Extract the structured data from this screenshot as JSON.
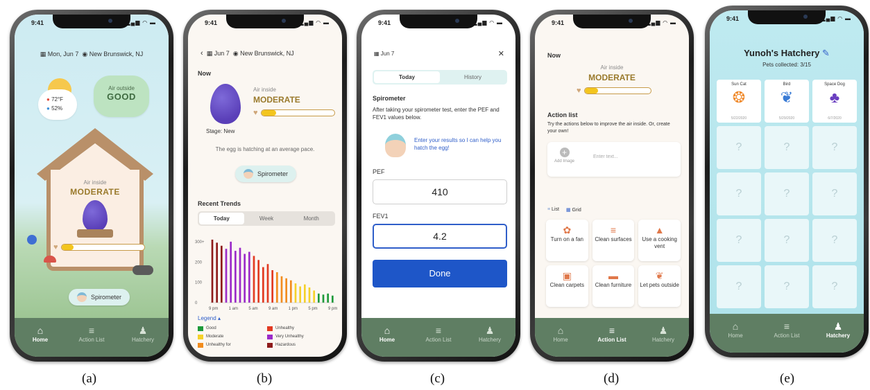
{
  "status_bar": {
    "time": "9:41",
    "signal": "▂▄▆ ◠ ▬"
  },
  "tabs": {
    "home": "Home",
    "action_list": "Action List",
    "hatchery": "Hatchery"
  },
  "captions": [
    "(a)",
    "(b)",
    "(c)",
    "(d)",
    "(e)"
  ],
  "screen_a": {
    "date": "Mon, Jun 7",
    "location": "New Brunswick, NJ",
    "temperature": "72°F",
    "humidity": "52%",
    "air_outside_label": "Air outside",
    "air_outside_value": "GOOD",
    "air_inside_label": "Air inside",
    "air_inside_value": "MODERATE",
    "meter_fraction": 0.15,
    "spirometer_label": "Spirometer"
  },
  "screen_b": {
    "date": "Jun 7",
    "location": "New Brunswick, NJ",
    "now_label": "Now",
    "air_inside_label": "Air inside",
    "air_inside_value": "MODERATE",
    "stage_text": "Stage: New",
    "hatch_text": "The egg is hatching at an average pace.",
    "spirometer_label": "Spirometer",
    "recent_trends": "Recent Trends",
    "seg_tabs": [
      "Today",
      "Week",
      "Month"
    ],
    "legend_title": "Legend",
    "legend": [
      {
        "label": "Good",
        "color": "#1e9a3a"
      },
      {
        "label": "Unhealthy",
        "color": "#e23a22"
      },
      {
        "label": "Moderate",
        "color": "#f5d12a"
      },
      {
        "label": "Very Unhealthy",
        "color": "#9b2bc9"
      },
      {
        "label": "Unhealthy for",
        "color": "#f28c1e"
      },
      {
        "label": "Hazardous",
        "color": "#8e1b1b"
      }
    ],
    "meter_fraction": 0.2
  },
  "chart_data": {
    "type": "bar",
    "title": "",
    "ylim": [
      0,
      320
    ],
    "y_ticks": [
      "300+",
      "200",
      "100",
      "0"
    ],
    "x_ticks": [
      "9 pm",
      "1 am",
      "5 am",
      "9 am",
      "1 pm",
      "5 pm",
      "9 pm"
    ],
    "values": [
      310,
      295,
      280,
      265,
      300,
      255,
      270,
      240,
      250,
      230,
      210,
      175,
      190,
      160,
      150,
      130,
      120,
      110,
      95,
      80,
      90,
      75,
      60,
      45,
      40,
      45,
      35
    ],
    "colors": [
      "#8e1b1b",
      "#8e1b1b",
      "#8e1b1b",
      "#9b2bc9",
      "#9b2bc9",
      "#9b2bc9",
      "#9b2bc9",
      "#9b2bc9",
      "#9b2bc9",
      "#e23a22",
      "#e23a22",
      "#e23a22",
      "#e23a22",
      "#e23a22",
      "#f28c1e",
      "#f28c1e",
      "#f28c1e",
      "#f28c1e",
      "#f5d12a",
      "#f5d12a",
      "#f5d12a",
      "#f5d12a",
      "#f5d12a",
      "#1e9a3a",
      "#1e9a3a",
      "#1e9a3a",
      "#1e9a3a"
    ]
  },
  "screen_c": {
    "date": "Jun 7",
    "close": "✕",
    "seg_tabs": [
      "Today",
      "History"
    ],
    "title": "Spirometer",
    "instructions": "After taking your spirometer test, enter the PEF and FEV1 values below.",
    "nurse_message": "Enter your results so I can help you hatch the egg!",
    "pef_label": "PEF",
    "pef_value": "410",
    "fev1_label": "FEV1",
    "fev1_value": "4.2",
    "done_label": "Done"
  },
  "screen_d": {
    "now_label": "Now",
    "air_inside_label": "Air inside",
    "air_inside_value": "MODERATE",
    "meter_fraction": 0.2,
    "action_list_title": "Action list",
    "action_list_desc": "Try the actions below to improve the air inside. Or, create your own!",
    "add_image_label": "Add Image",
    "enter_text_placeholder": "Enter text...",
    "view_list": "List",
    "view_grid": "Grid",
    "actions": [
      {
        "label": "Turn on a fan",
        "icon": "✿"
      },
      {
        "label": "Clean surfaces",
        "icon": "≡"
      },
      {
        "label": "Use a cooking vent",
        "icon": "▲"
      },
      {
        "label": "Clean carpets",
        "icon": "▣"
      },
      {
        "label": "Clean furniture",
        "icon": "▬"
      },
      {
        "label": "Let pets outside",
        "icon": "❦"
      }
    ]
  },
  "screen_e": {
    "title": "Yunoh's Hatchery",
    "pets_collected": "Pets collected: 3/15",
    "pets": [
      {
        "name": "Sun Cat",
        "date": "5/22/2020",
        "icon": "❂",
        "color": "#f08a2c"
      },
      {
        "name": "Bird",
        "date": "5/29/2020",
        "icon": "❦",
        "color": "#3a7bd5"
      },
      {
        "name": "Space Dog",
        "date": "6/7/2020",
        "icon": "♣",
        "color": "#6a3fc0"
      }
    ],
    "locked_mark": "?"
  }
}
